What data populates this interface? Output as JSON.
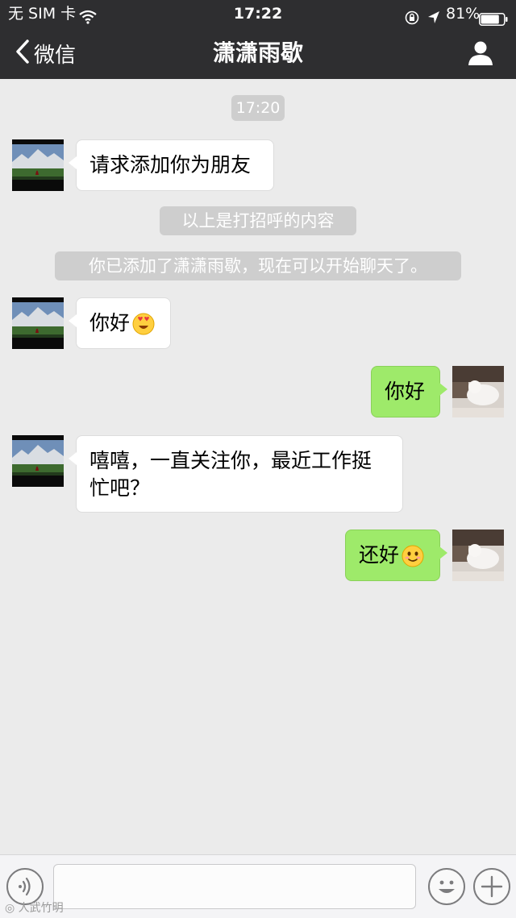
{
  "status_bar": {
    "carrier": "无 SIM 卡",
    "time": "17:22",
    "battery": "81%",
    "battery_level": 0.81
  },
  "nav": {
    "back_label": "微信",
    "title": "潇潇雨歇"
  },
  "chat": {
    "timestamp": "17:20",
    "messages": [
      {
        "side": "in",
        "text": "请求添加你为朋友"
      },
      {
        "side": "in",
        "text": "你好",
        "emoji": "heart-eyes-emoji-icon"
      },
      {
        "side": "out",
        "text": "你好"
      },
      {
        "side": "in",
        "text": "嘻嘻，一直关注你，最近工作挺忙吧？"
      },
      {
        "side": "out",
        "text": "还好",
        "emoji": "smile-emoji-icon"
      }
    ],
    "system_notices": [
      "以上是打招呼的内容",
      "你已添加了潇潇雨歇，现在可以开始聊天了。"
    ]
  },
  "input_bar": {
    "value": "",
    "placeholder": ""
  },
  "watermark": "人武竹明",
  "colors": {
    "header_bg": "#2e2e30",
    "chat_bg": "#ebebeb",
    "outgoing_bubble": "#9eea6a",
    "incoming_bubble": "#ffffff",
    "notice_pill": "#cecece"
  }
}
